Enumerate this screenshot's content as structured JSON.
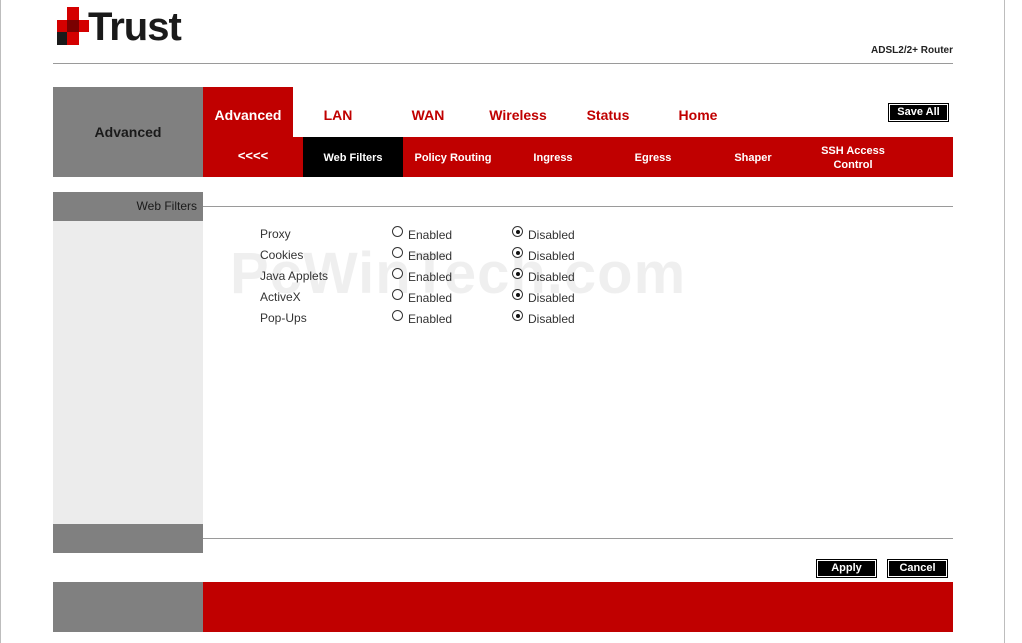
{
  "brand": {
    "logo_text": "Trust",
    "product": "ADSL2/2+ Router"
  },
  "header": {
    "section_title": "Advanced",
    "nav": [
      "Advanced",
      "LAN",
      "WAN",
      "Wireless",
      "Status",
      "Home"
    ],
    "active_nav": "Advanced",
    "save_all": "Save All"
  },
  "subnav": {
    "back": "<<<<",
    "items": [
      "Web Filters",
      "Policy Routing",
      "Ingress",
      "Egress",
      "Shaper",
      "SSH Access Control"
    ],
    "active": "Web Filters"
  },
  "sidebar": {
    "title": "Web Filters"
  },
  "filters": {
    "enabled_label": "Enabled",
    "disabled_label": "Disabled",
    "rows": [
      {
        "name": "Proxy",
        "value": "Disabled"
      },
      {
        "name": "Cookies",
        "value": "Disabled"
      },
      {
        "name": "Java Applets",
        "value": "Disabled"
      },
      {
        "name": "ActiveX",
        "value": "Disabled"
      },
      {
        "name": "Pop-Ups",
        "value": "Disabled"
      }
    ]
  },
  "actions": {
    "apply": "Apply",
    "cancel": "Cancel"
  },
  "watermark": "PcWinTech.com",
  "colors": {
    "brand_red": "#c00000",
    "gray": "#808080",
    "sidebar_bg": "#ececec"
  }
}
